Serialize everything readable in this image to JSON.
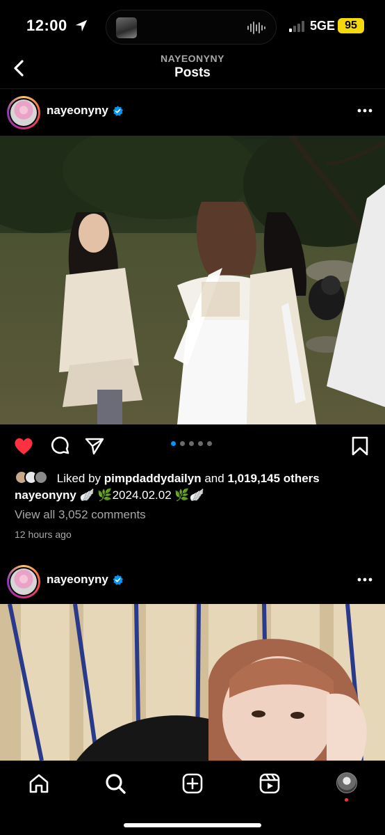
{
  "status_bar": {
    "time": "12:00",
    "network": "5GE",
    "battery": "95"
  },
  "header": {
    "username": "NAYEONYNY",
    "title": "Posts"
  },
  "post1": {
    "username": "nayeonyny",
    "likes_prefix": "Liked by",
    "liked_by": "pimpdaddydailyn",
    "likes_and": "and",
    "likes_others": "1,019,145 others",
    "caption_user": "nayeonyny",
    "caption_text": "🪽 🌿2024.02.02 🌿🪽",
    "comments_link": "View all 3,052 comments",
    "time_ago": "12 hours ago",
    "carousel_count": 5,
    "carousel_active": 1
  },
  "post2": {
    "username": "nayeonyny"
  },
  "colors": {
    "like_red": "#ff3040",
    "carousel_active": "#0095f6",
    "verified_blue": "#0095f6"
  },
  "icons": {
    "back": "chevron-left-icon",
    "more": "more-horizontal-icon",
    "like": "heart-filled-icon",
    "comment": "comment-icon",
    "share": "send-icon",
    "save": "bookmark-icon",
    "home": "home-icon",
    "search": "search-icon",
    "create": "create-icon",
    "reels": "reels-icon"
  }
}
